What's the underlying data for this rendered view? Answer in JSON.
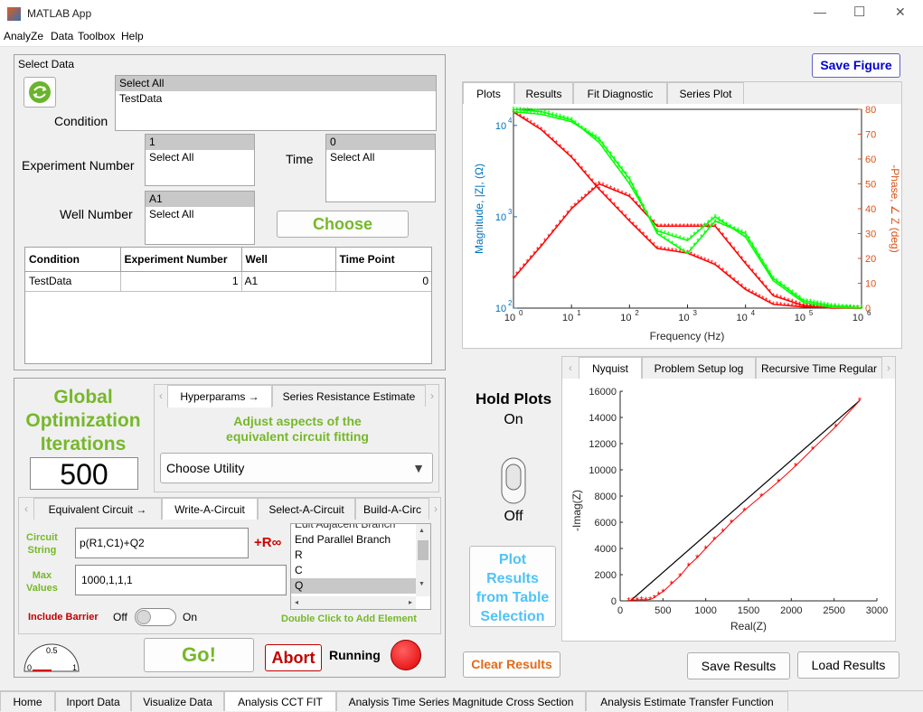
{
  "window": {
    "title": "MATLAB App",
    "minimize": "—",
    "maximize": "☐",
    "close": "✕"
  },
  "menu": [
    "AnalyZe",
    "Data",
    "Toolbox",
    "Help"
  ],
  "select_data": {
    "title": "Select Data",
    "condition_label": "Condition",
    "condition_items": [
      "Select All",
      "TestData"
    ],
    "experiment_label": "Experiment Number",
    "experiment_items": [
      "1",
      "Select All"
    ],
    "time_label": "Time",
    "time_items": [
      "0",
      "Select All"
    ],
    "well_label": "Well Number",
    "well_items": [
      "A1",
      "Select All"
    ],
    "choose_label": "Choose",
    "table": {
      "headers": [
        "Condition",
        "Experiment Number",
        "Well",
        "Time Point"
      ],
      "rows": [
        [
          "TestData",
          "1",
          "A1",
          "0"
        ]
      ]
    }
  },
  "optimization": {
    "title_lines": [
      "Global",
      "Optimization",
      "Iterations"
    ],
    "value": "500",
    "tabs": [
      "Hyperparams →",
      "Series Resistance Estimate"
    ],
    "adjust_text_lines": [
      "Adjust aspects of the",
      "equivalent circuit fitting"
    ],
    "utility_placeholder": "Choose Utility",
    "circuit_tabs": [
      "Equivalent Circuit →",
      "Write-A-Circuit",
      "Select-A-Circuit",
      "Build-A-Circ"
    ],
    "circuit_string_label_lines": [
      "Circuit",
      "String"
    ],
    "circuit_string_value": "p(R1,C1)+Q2",
    "add_r_label": "+R∞",
    "max_values_label_lines": [
      "Max",
      "Values"
    ],
    "max_values_value": "1000,1,1,1",
    "element_list": [
      "Edit Adjacent Branch",
      "End Parallel Branch",
      "R",
      "C",
      "Q"
    ],
    "element_selected": "Q",
    "double_click_hint": "Double Click to Add Element",
    "barrier_label": "Include Barrier",
    "barrier_off": "Off",
    "barrier_on": "On",
    "gauge_min": "0",
    "gauge_mid": "0.5",
    "gauge_max": "1",
    "go_label": "Go!",
    "abort_label": "Abort",
    "running_label": "Running"
  },
  "toolbar": {
    "save_figure": "Save Figure",
    "clear_results": "Clear Results",
    "save_results": "Save Results",
    "load_results": "Load Results"
  },
  "plot_tabs": [
    "Plots",
    "Results",
    "Fit Diagnostic",
    "Series Plot"
  ],
  "bode": {
    "type": "line",
    "xlabel": "Frequency (Hz)",
    "ylabel_left": "Magnitude, |Z|, (Ω)",
    "ylabel_right": "-Phase, ∠ Z (deg)",
    "x_ticks": [
      "10",
      "10",
      "10",
      "10",
      "10",
      "10",
      "10"
    ],
    "x_exponents": [
      "0",
      "1",
      "2",
      "3",
      "4",
      "5",
      "6"
    ],
    "y_left_ticks": [
      "10",
      "10",
      "10"
    ],
    "y_left_exponents": [
      "2",
      "3",
      "4"
    ],
    "y_right_ticks": [
      "0",
      "10",
      "20",
      "30",
      "40",
      "50",
      "60",
      "70",
      "80"
    ],
    "xlim": [
      1,
      1000000
    ],
    "ylim_left": [
      100,
      15000
    ],
    "ylim_right": [
      0,
      80
    ],
    "scale": "log-log"
  },
  "hold_plots": {
    "label": "Hold Plots",
    "state": "On",
    "off_label": "Off"
  },
  "plot_results_lines": [
    "Plot",
    "Results",
    "from Table",
    "Selection"
  ],
  "nyquist_tabs": [
    "Nyquist",
    "Problem Setup log",
    "Recursive Time Regular"
  ],
  "chart_data": [
    {
      "type": "line",
      "title": "",
      "xlabel": "Frequency (Hz)",
      "ylabel": "Magnitude, |Z|, (Ω)",
      "x_scale": "log",
      "y_scale": "log",
      "xlim": [
        1,
        1000000
      ],
      "ylim": [
        100,
        15000
      ],
      "series": [
        {
          "color": "#ff0000",
          "x": [
            1,
            3,
            10,
            30,
            100,
            300,
            1000,
            3000,
            10000,
            30000,
            100000,
            300000,
            1000000
          ],
          "y": [
            14000,
            9000,
            4500,
            2000,
            900,
            450,
            400,
            300,
            160,
            110,
            103,
            101,
            100
          ],
          "y2": [
            12,
            25,
            40,
            50,
            45,
            33,
            33,
            33,
            18,
            5,
            1,
            0,
            0
          ]
        },
        {
          "color": "#00ff00",
          "x": [
            1,
            3,
            10,
            30,
            100,
            300,
            1000,
            3000,
            10000,
            30000,
            100000,
            300000,
            1000000
          ],
          "y": [
            15000,
            14200,
            11500,
            6500,
            2300,
            700,
            550,
            1000,
            600,
            200,
            115,
            102,
            100
          ],
          "y2": [
            79,
            78,
            75,
            68,
            52,
            30,
            22,
            35,
            30,
            12,
            3,
            1,
            0
          ]
        }
      ]
    },
    {
      "type": "scatter",
      "title": "",
      "xlabel": "Real(Z)",
      "ylabel": "-Imag(Z)",
      "xlim": [
        0,
        3000
      ],
      "ylim": [
        0,
        16000
      ],
      "x_ticks": [
        "0",
        "500",
        "1000",
        "1500",
        "2000",
        "2500",
        "3000"
      ],
      "y_ticks": [
        "0",
        "2000",
        "4000",
        "6000",
        "8000",
        "10000",
        "12000",
        "14000",
        "16000"
      ],
      "series": [
        {
          "color": "#ff0000",
          "x": [
            100,
            150,
            200,
            250,
            300,
            350,
            400,
            450,
            500,
            600,
            700,
            800,
            900,
            1000,
            1100,
            1200,
            1300,
            1450,
            1650,
            1850,
            2050,
            2250,
            2520,
            2800
          ],
          "y": [
            30,
            60,
            80,
            90,
            80,
            100,
            250,
            500,
            700,
            1300,
            1900,
            2700,
            3300,
            4000,
            4700,
            5300,
            6000,
            6900,
            8000,
            9100,
            10300,
            11600,
            13300,
            15300
          ]
        },
        {
          "color": "#000000",
          "x": [
            120,
            2800
          ],
          "y": [
            0,
            15300
          ]
        }
      ]
    }
  ],
  "bottom_tabs": [
    "Home",
    "Inport Data",
    "Visualize Data",
    "Analysis CCT FIT",
    "Analysis Time Series Magnitude Cross Section",
    "Analysis Estimate Transfer Function"
  ],
  "active_bottom_tab": "Analysis CCT FIT"
}
